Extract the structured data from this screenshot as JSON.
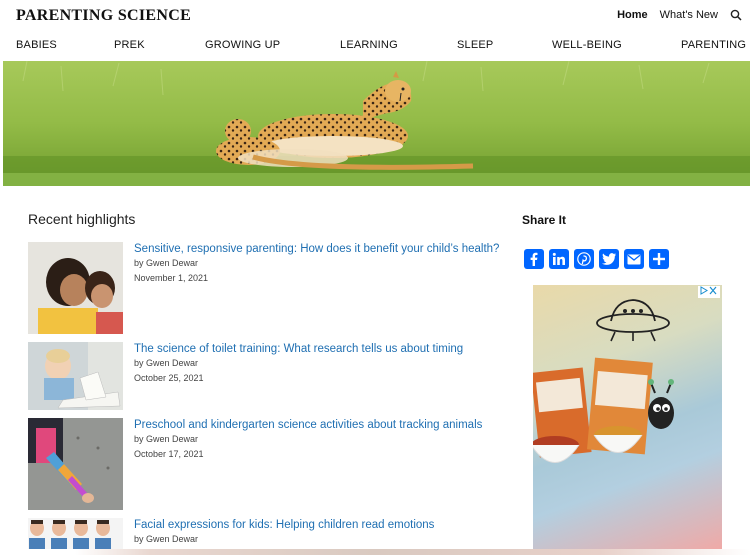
{
  "site": {
    "logo": "PARENTING SCIENCE"
  },
  "toplinks": {
    "home": "Home",
    "whats_new": "What's New",
    "search_icon": "search-icon"
  },
  "nav": [
    {
      "label": "BABIES"
    },
    {
      "label": "PREK"
    },
    {
      "label": "GROWING UP"
    },
    {
      "label": "LEARNING"
    },
    {
      "label": "SLEEP"
    },
    {
      "label": "WELL-BEING"
    },
    {
      "label": "PARENTING"
    }
  ],
  "main": {
    "section_title": "Recent highlights",
    "articles": [
      {
        "title": "Sensitive, responsive parenting: How does it benefit your child’s health?",
        "author": "by Gwen Dewar",
        "date": "November 1, 2021"
      },
      {
        "title": "The science of toilet training: What research tells us about timing",
        "author": "by Gwen Dewar",
        "date": "October 25, 2021"
      },
      {
        "title": "Preschool and kindergarten science activities about tracking animals",
        "author": "by Gwen Dewar",
        "date": "October 17, 2021"
      },
      {
        "title": "Facial expressions for kids: Helping children read emotions",
        "author": "by Gwen Dewar",
        "date": ""
      }
    ]
  },
  "sidebar": {
    "share_title": "Share It",
    "share_buttons": [
      "facebook-icon",
      "linkedin-icon",
      "pinterest-icon",
      "twitter-icon",
      "email-icon",
      "share-plus-icon"
    ],
    "share_color": "#0166ff"
  }
}
